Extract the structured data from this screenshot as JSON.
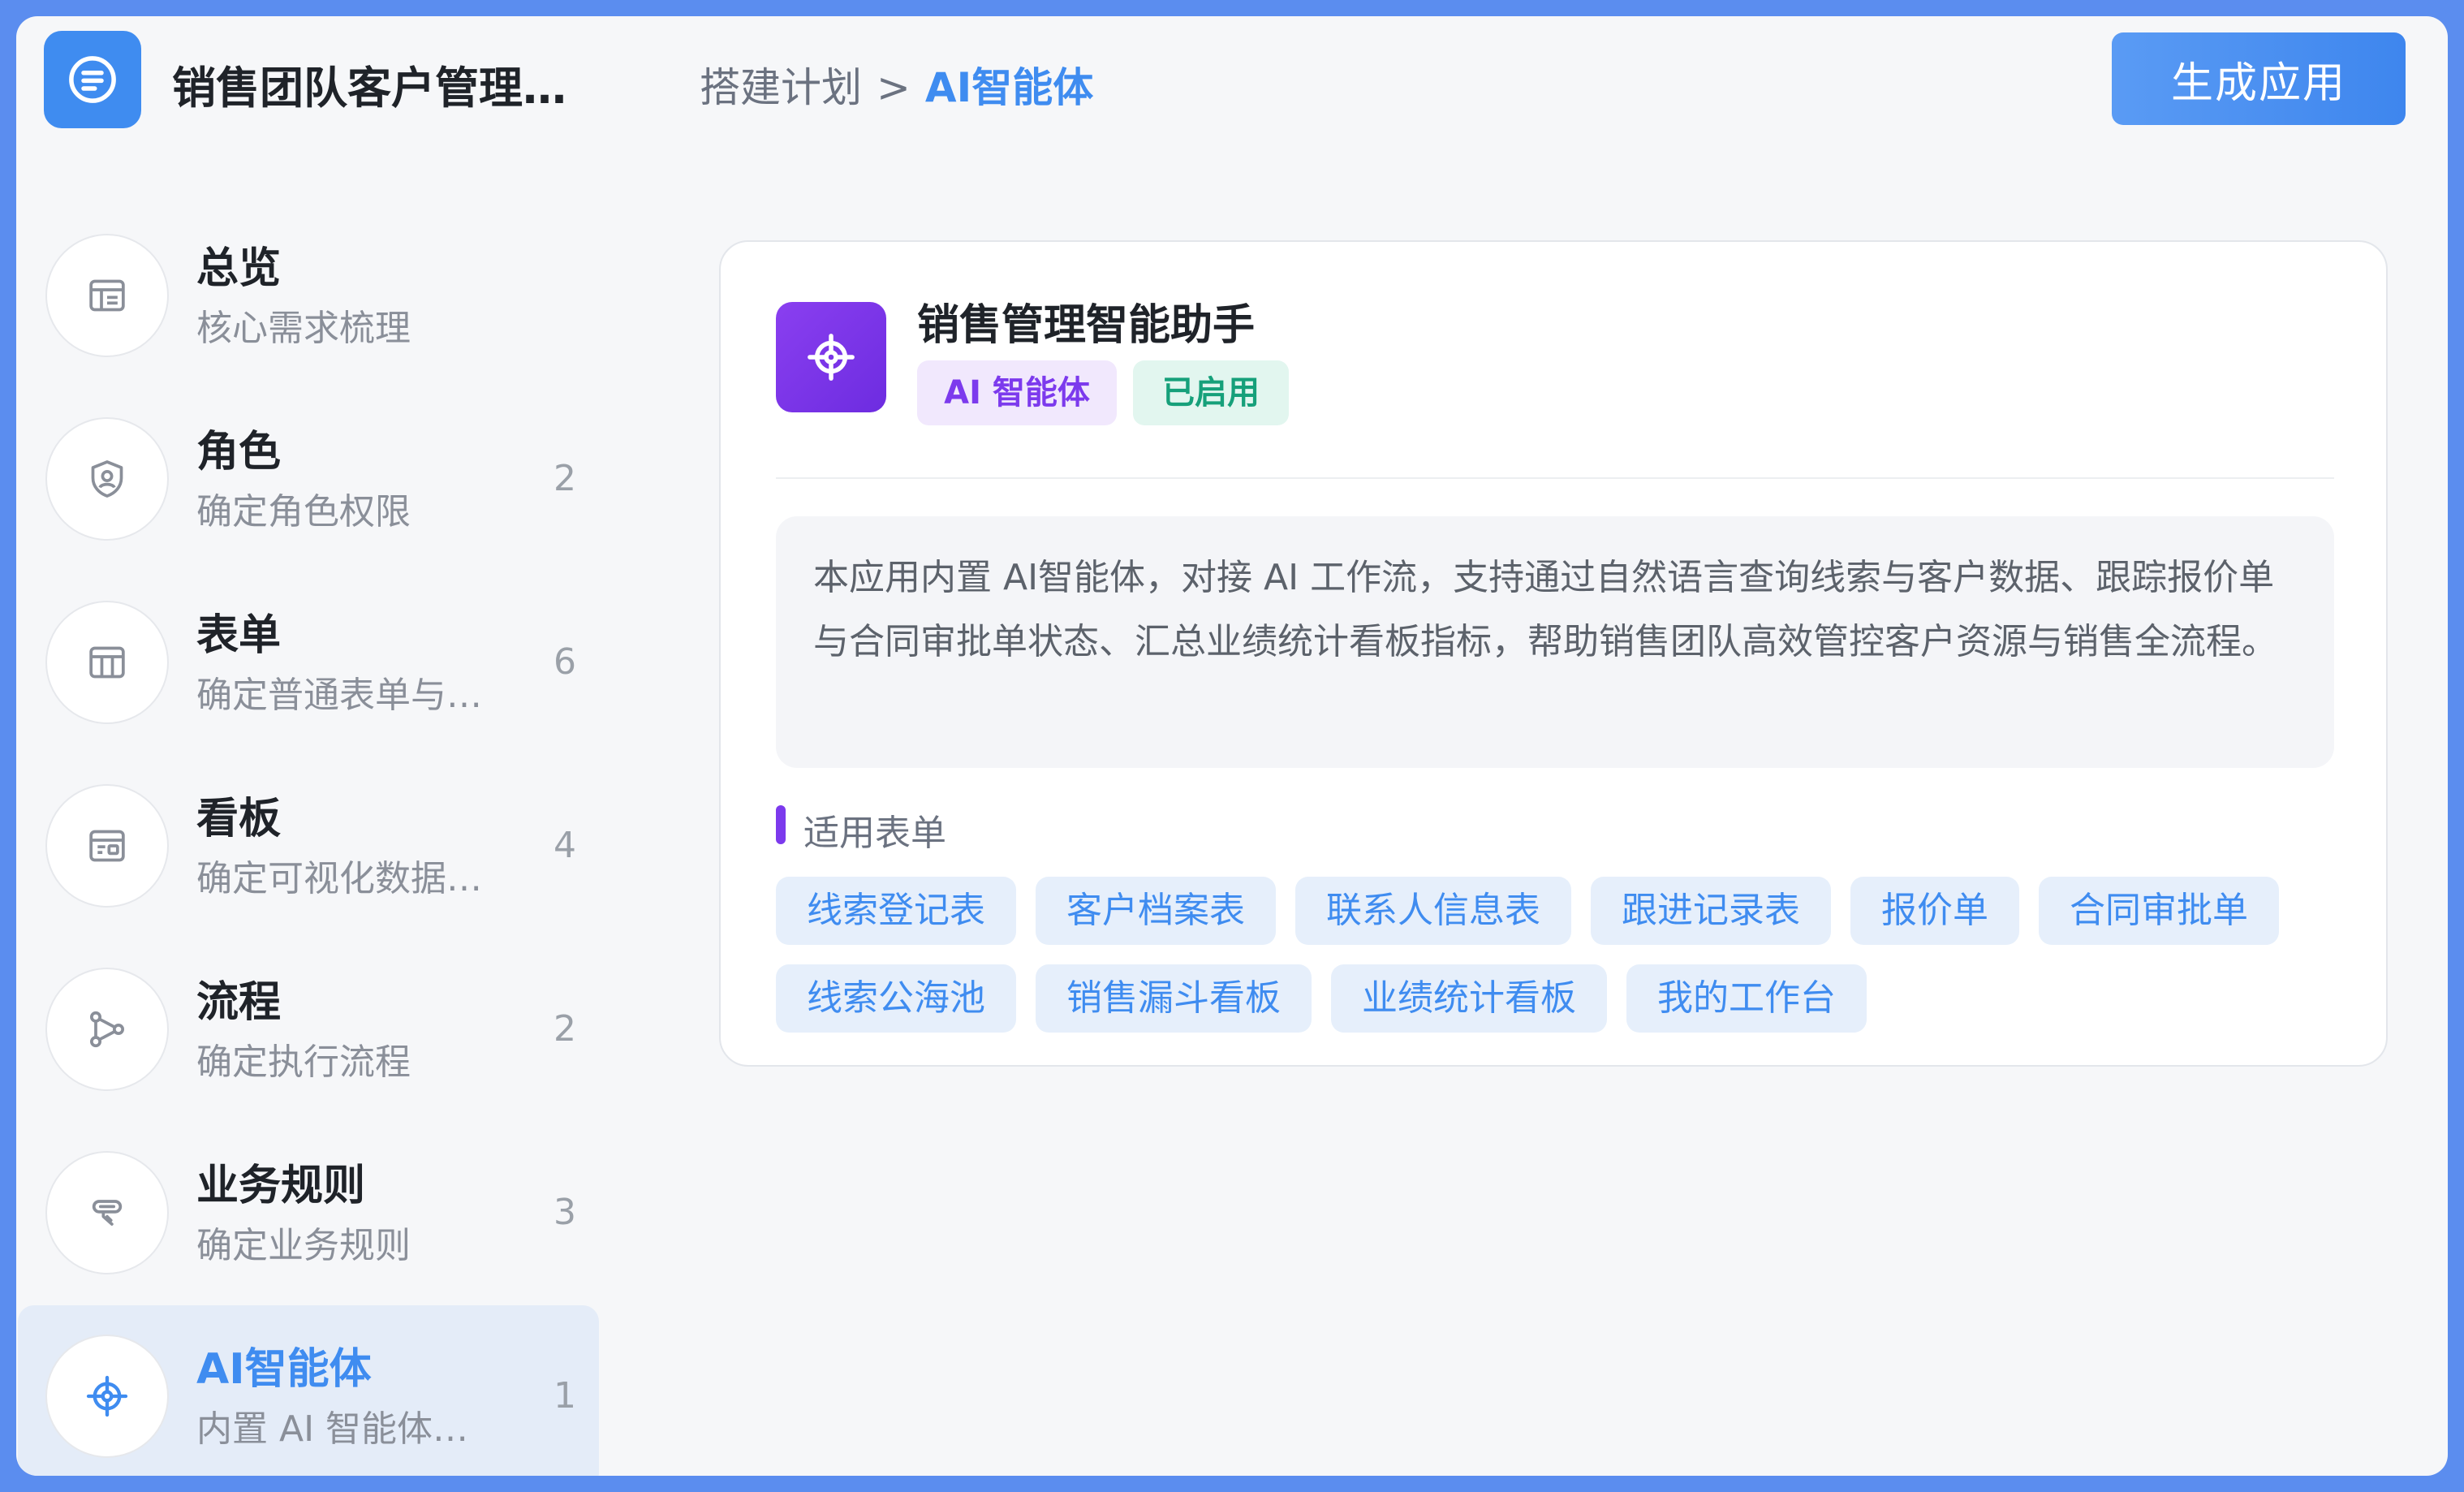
{
  "app": {
    "title": "销售团队客户管理系统",
    "logo_icon": "document-list-icon"
  },
  "breadcrumb": {
    "parent": "搭建计划",
    "separator": ">",
    "current": "AI智能体"
  },
  "header": {
    "generate_button_label": "生成应用"
  },
  "sidebar": {
    "items": [
      {
        "icon": "overview-icon",
        "title": "总览",
        "subtitle": "核心需求梳理",
        "count": ""
      },
      {
        "icon": "shield-user-icon",
        "title": "角色",
        "subtitle": "确定角色权限",
        "count": "2"
      },
      {
        "icon": "table-icon",
        "title": "表单",
        "subtitle": "确定普通表单与…",
        "count": "6"
      },
      {
        "icon": "dashboard-icon",
        "title": "看板",
        "subtitle": "确定可视化数据…",
        "count": "4"
      },
      {
        "icon": "flow-icon",
        "title": "流程",
        "subtitle": "确定执行流程",
        "count": "2"
      },
      {
        "icon": "rule-icon",
        "title": "业务规则",
        "subtitle": "确定业务规则",
        "count": "3"
      },
      {
        "icon": "ai-agent-icon",
        "title": "AI智能体",
        "subtitle": "内置 AI 智能体…",
        "count": "1",
        "active": true
      }
    ]
  },
  "agent": {
    "icon": "gear-agent-icon",
    "name": "销售管理智能助手",
    "tag_type": "AI 智能体",
    "tag_status": "已启用",
    "description": "本应用内置 AI智能体，对接 AI 工作流，支持通过自然语言查询线索与客户数据、跟踪报价单与合同审批单状态、汇总业绩统计看板指标，帮助销售团队高效管控客户资源与销售全流程。",
    "section_title": "适用表单",
    "forms": [
      "线索登记表",
      "客户档案表",
      "联系人信息表",
      "跟进记录表",
      "报价单",
      "合同审批单",
      "线索公海池",
      "销售漏斗看板",
      "业绩统计看板",
      "我的工作台"
    ]
  },
  "colors": {
    "accent": "#3f8cf0",
    "agent_purple": "#7c3aed",
    "status_green": "#16a07a",
    "frame_border": "#5b8def"
  }
}
